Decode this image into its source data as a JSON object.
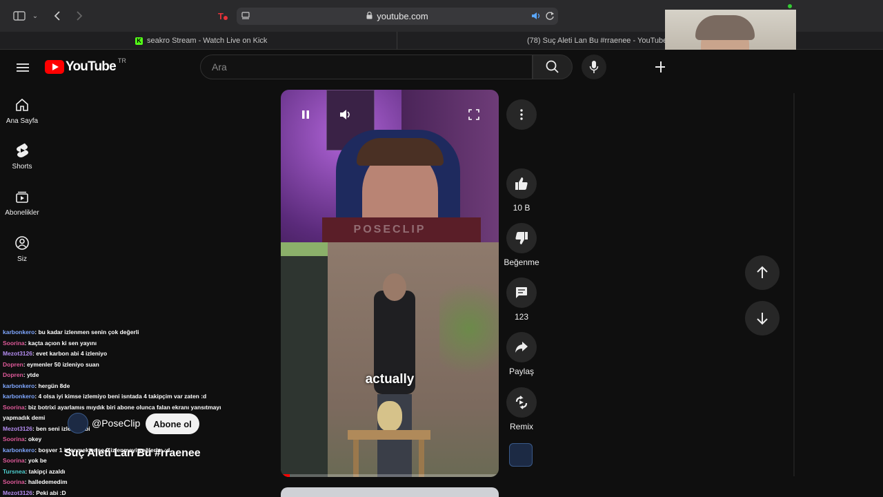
{
  "browser": {
    "url": "youtube.com",
    "tabs": [
      {
        "label": "seakro Stream - Watch Live on Kick"
      },
      {
        "label": "(78) Suç Aleti Lan Bu #rraenee - YouTube"
      }
    ]
  },
  "header": {
    "logo_text": "YouTube",
    "region": "TR",
    "search_placeholder": "Ara"
  },
  "sidebar": {
    "items": [
      {
        "label": "Ana Sayfa",
        "icon": "home-icon"
      },
      {
        "label": "Shorts",
        "icon": "shorts-icon"
      },
      {
        "label": "Abonelikler",
        "icon": "subscriptions-icon"
      },
      {
        "label": "Siz",
        "icon": "account-icon"
      }
    ]
  },
  "video": {
    "watermark": "POSECLIP",
    "caption": "actually",
    "channel": "@PoseClip",
    "subscribe_label": "Abone ol",
    "title": "Suç Aleti Lan Bu  #rraenee",
    "progress": 0.04
  },
  "actions": {
    "likes": "10 B",
    "dislike_label": "Beğenme",
    "comments": "123",
    "share_label": "Paylaş",
    "remix_label": "Remix"
  },
  "chat": [
    {
      "user": "karbonkero",
      "text": ": bu kadar izlenmen senin çok değerli",
      "cls": "u1"
    },
    {
      "user": "Soorina",
      "text": ": kaçta açıon ki sen yayını",
      "cls": "u2"
    },
    {
      "user": "Mezot3126",
      "text": ": evet karbon abi 4 izleniyo",
      "cls": "u3"
    },
    {
      "user": "Dopren",
      "text": ": eymenler 50 izleniyo suan",
      "cls": "u2"
    },
    {
      "user": "Dopren",
      "text": ": ytde",
      "cls": "u2"
    },
    {
      "user": "karbonkero",
      "text": ": hergün 8de",
      "cls": "u1"
    },
    {
      "user": "karbonkero",
      "text": ": 4 olsa iyi kimse izlemiyo beni isntada 4 takipçim var zaten :d",
      "cls": "u1"
    },
    {
      "user": "Soorina",
      "text": ": biz botrixi ayarlamıs mıydık biri abone olunca falan ekranı yansıtmayı",
      "cls": "u2"
    },
    {
      "user": "",
      "text": "yapmadık demi",
      "cls": "u2"
    },
    {
      "user": "Mezot3126",
      "text": ": ben seni izlerim abi",
      "cls": "u3"
    },
    {
      "user": "Soorina",
      "text": ": okey",
      "cls": "u2"
    },
    {
      "user": "karbonkero",
      "text": ": boşver 1 izlenmektense 0 izlenmeyi yeğlerim :d",
      "cls": "u1"
    },
    {
      "user": "Soorina",
      "text": ": yok be",
      "cls": "u2"
    },
    {
      "user": "Tursnea",
      "text": ": takipçi azaldı",
      "cls": "u4"
    },
    {
      "user": "Soorina",
      "text": ": halledemedim",
      "cls": "u2"
    },
    {
      "user": "Mezot3126",
      "text": ": Peki abi :D",
      "cls": "u3"
    }
  ]
}
